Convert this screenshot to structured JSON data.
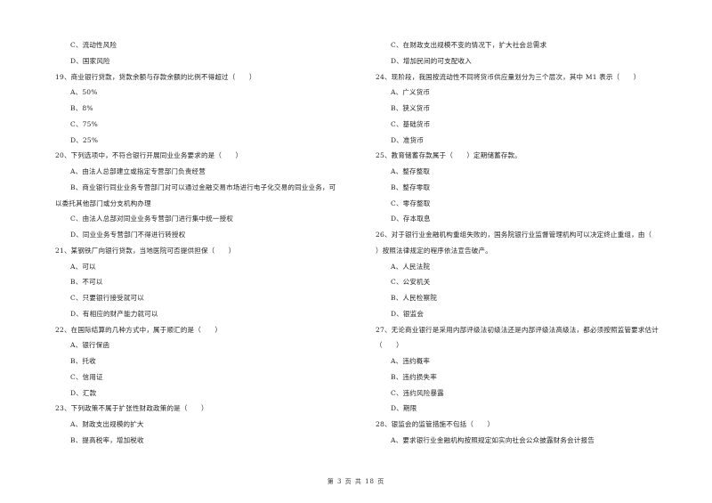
{
  "left_column": [
    {
      "type": "opt",
      "text": "C、流动性风险"
    },
    {
      "type": "opt",
      "text": "D、国家风险"
    },
    {
      "type": "q",
      "text": "19、商业银行贷款，贷款余额与存款余额的比例不得超过（　　）"
    },
    {
      "type": "opt",
      "text": "A、50%"
    },
    {
      "type": "opt",
      "text": "B、8%"
    },
    {
      "type": "opt",
      "text": "C、75%"
    },
    {
      "type": "opt",
      "text": "D、25%"
    },
    {
      "type": "q",
      "text": "20、下列选项中，不符合银行开展同业业务要求的是（　　）"
    },
    {
      "type": "opt",
      "text": "A、由法人总部建立或指定专营部门负责经营"
    },
    {
      "type": "opt",
      "text": "B、商业银行同业业务专营部门对可以通过金融交易市场进行电子化交易的同业业务，可"
    },
    {
      "type": "q",
      "text": "以委托其他部门或分支机构办理"
    },
    {
      "type": "opt",
      "text": "C、由法人总部对同业业务专营部门进行集中统一授权"
    },
    {
      "type": "opt",
      "text": "D、同业业务专营部门不得进行转授权"
    },
    {
      "type": "q",
      "text": "21、某钢铁厂向银行贷款，当地医院可否提供担保（　　）"
    },
    {
      "type": "opt",
      "text": "A、可以"
    },
    {
      "type": "opt",
      "text": "B、不可以"
    },
    {
      "type": "opt",
      "text": "C、只要银行接受就可以"
    },
    {
      "type": "opt",
      "text": "D、有相应的财产能力就可以"
    },
    {
      "type": "q",
      "text": "22、在国际结算的几种方式中，属于顺汇的是（　　）"
    },
    {
      "type": "opt",
      "text": "A、银行保函"
    },
    {
      "type": "opt",
      "text": "B、托收"
    },
    {
      "type": "opt",
      "text": "C、信用证"
    },
    {
      "type": "opt",
      "text": "D、汇款"
    },
    {
      "type": "q",
      "text": "23、下列政策不属于扩张性财政政策的是（　　）"
    },
    {
      "type": "opt",
      "text": "A、财政支出规模的扩大"
    },
    {
      "type": "opt",
      "text": "B、提高税率，增加税收"
    }
  ],
  "right_column": [
    {
      "type": "opt",
      "text": "C、在财政支出规模不变的情况下，扩大社会总需求"
    },
    {
      "type": "opt",
      "text": "D、增加民间的可支配收入"
    },
    {
      "type": "q",
      "text": "24、现阶段，我国按流动性不同将货币供应量划分为三个层次，其中 M1 表示（　　）"
    },
    {
      "type": "opt",
      "text": "A、广义货币"
    },
    {
      "type": "opt",
      "text": "B、狭义货币"
    },
    {
      "type": "opt",
      "text": "C、基础货币"
    },
    {
      "type": "opt",
      "text": "D、准货币"
    },
    {
      "type": "q",
      "text": "25、教育储蓄存款属于（　　）定期储蓄存款。"
    },
    {
      "type": "opt",
      "text": "A、整存整取"
    },
    {
      "type": "opt",
      "text": "B、整存零取"
    },
    {
      "type": "opt",
      "text": "C、零存整取"
    },
    {
      "type": "opt",
      "text": "D、存本取息"
    },
    {
      "type": "q",
      "text": "26、对于银行业金融机构重组失败的，国务院银行业监督管理机构可以决定终止重组，由（"
    },
    {
      "type": "q",
      "text": "）按照法律规定的程序依法宣告破产。"
    },
    {
      "type": "opt",
      "text": "A、人民法院"
    },
    {
      "type": "opt",
      "text": "C、公安机关"
    },
    {
      "type": "opt",
      "text": "B、人民检察院"
    },
    {
      "type": "opt",
      "text": "D、银监会"
    },
    {
      "type": "q",
      "text": "27、无论商业银行是采用内部评级法初级法还是内部评级法高级法，都必须按照监管要求估计"
    },
    {
      "type": "q",
      "text": "（　　）"
    },
    {
      "type": "opt",
      "text": "A、违约概率"
    },
    {
      "type": "opt",
      "text": "B、违约损失率"
    },
    {
      "type": "opt",
      "text": "C、违约风险暴露"
    },
    {
      "type": "opt",
      "text": "D、期限"
    },
    {
      "type": "q",
      "text": "28、银监会的监管措施不包括（　　）"
    },
    {
      "type": "opt",
      "text": "A、要求银行业金融机构按照规定如实向社会公众披露财务会计报告"
    }
  ],
  "footer": {
    "text": "第 3 页 共 18 页"
  }
}
